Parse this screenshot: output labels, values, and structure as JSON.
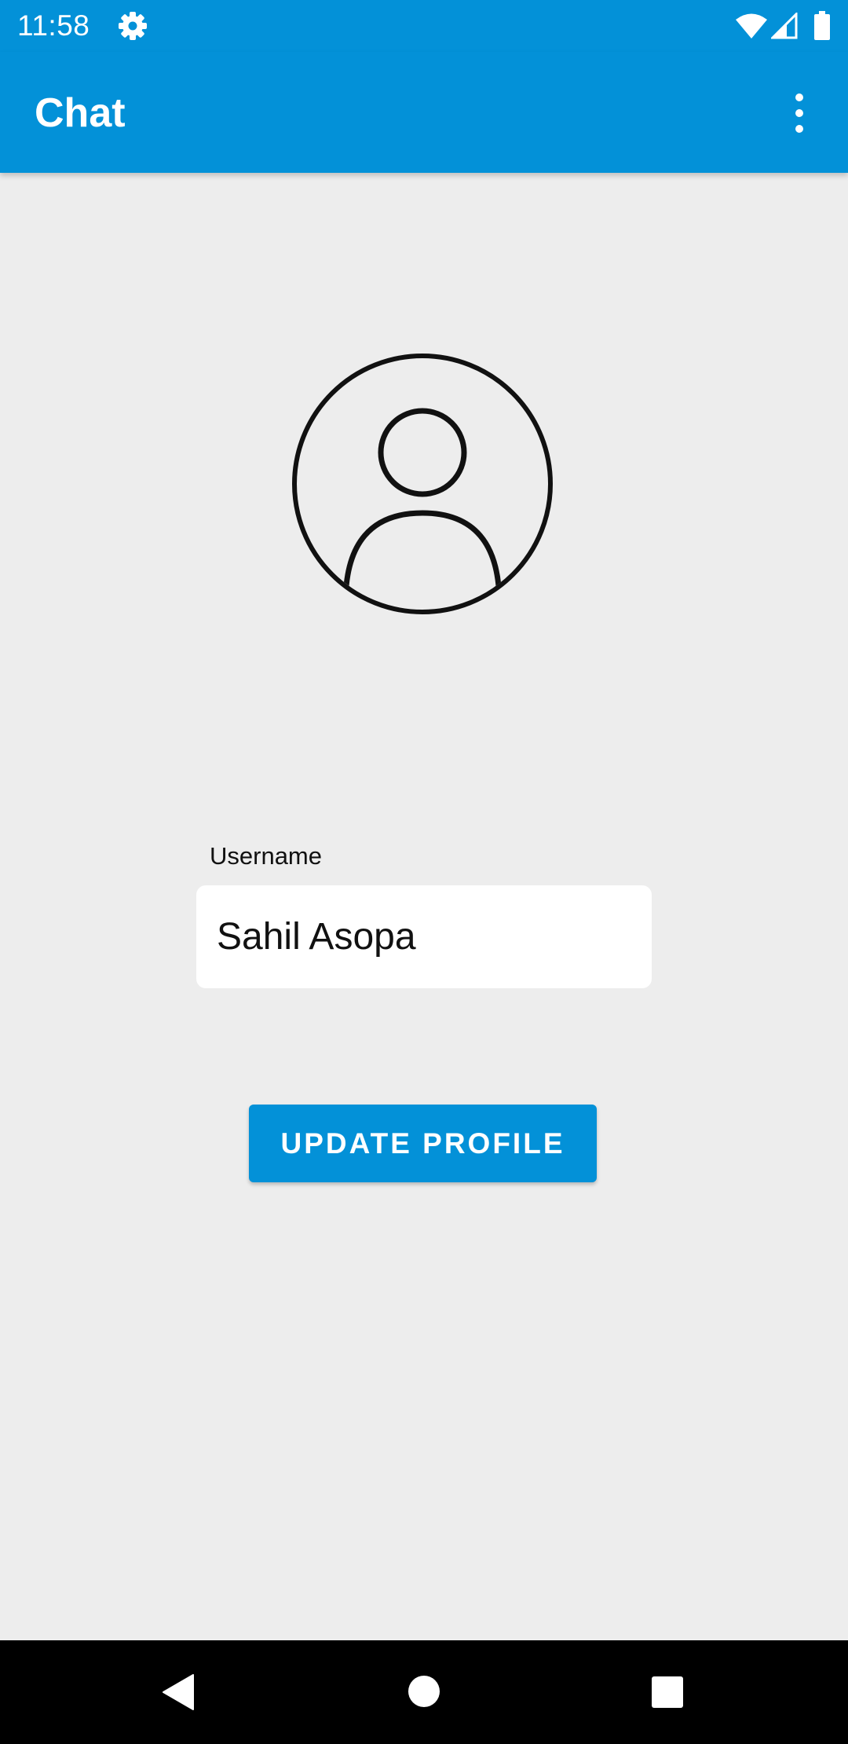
{
  "status_bar": {
    "time": "11:58",
    "icons": [
      "gear-icon",
      "wifi-icon",
      "cell-signal-icon",
      "battery-icon"
    ]
  },
  "app_bar": {
    "title": "Chat",
    "menu_icon": "more-vert-icon"
  },
  "profile": {
    "avatar_icon": "account-circle-icon",
    "username_label": "Username",
    "username_value": "Sahil Asopa",
    "update_button": "UPDATE PROFILE"
  },
  "nav_bar": {
    "icons": [
      "back-icon",
      "home-icon",
      "recents-icon"
    ]
  },
  "colors": {
    "primary": "#0391d8",
    "background": "#ededed",
    "field_background": "#ffffff",
    "nav_background": "#000000"
  }
}
